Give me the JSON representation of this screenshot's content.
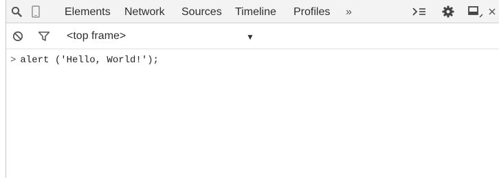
{
  "toolbar": {
    "tabs": [
      "Elements",
      "Network",
      "Sources",
      "Timeline",
      "Profiles"
    ],
    "more": "»"
  },
  "console_bar": {
    "frame_select": "<top frame>"
  },
  "console": {
    "prompt": ">",
    "command": "alert ('Hello, World!');"
  },
  "colors": {
    "toolbar_bg": "#f3f3f3",
    "text": "#303030"
  },
  "icons": [
    "search-icon",
    "device-mode-icon",
    "show-drawer-icon",
    "settings-gear-icon",
    "dock-side-icon",
    "close-icon",
    "clear-console-icon",
    "filter-icon",
    "dropdown-arrow-icon"
  ]
}
